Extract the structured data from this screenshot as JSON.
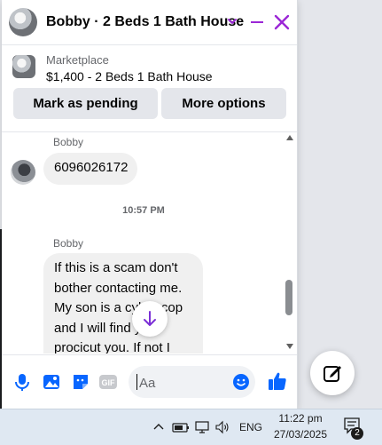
{
  "chat": {
    "title": "Bobby · 2 Beds 1 Bath House",
    "listing": {
      "label": "Marketplace",
      "price_title": "$1,400 - 2 Beds 1 Bath House",
      "pending_button": "Mark as pending",
      "more_button": "More options"
    },
    "messages": [
      {
        "sender": "Bobby",
        "text": "6096026172"
      },
      {
        "timestamp": "10:57 PM"
      },
      {
        "sender": "Bobby",
        "text": "If this is a scam don't bother contacting me. My son is a cyber cop and I will find you procicut you. If not I"
      }
    ],
    "composer": {
      "placeholder": "Aa"
    }
  },
  "taskbar": {
    "language": "ENG",
    "time": "11:22 pm",
    "date": "27/03/2025",
    "notification_count": "2"
  },
  "colors": {
    "accent": "#9b27d6",
    "messenger_blue": "#0866ff",
    "bubble": "#f0f0f0"
  },
  "icons": [
    "chevron-down-icon",
    "minimize-icon",
    "close-icon",
    "arrow-down-icon",
    "microphone-icon",
    "image-icon",
    "sticker-icon",
    "gif-icon",
    "emoji-icon",
    "like-icon",
    "compose-icon",
    "chevron-up-icon",
    "battery-icon",
    "network-icon",
    "volume-icon",
    "notification-icon"
  ]
}
